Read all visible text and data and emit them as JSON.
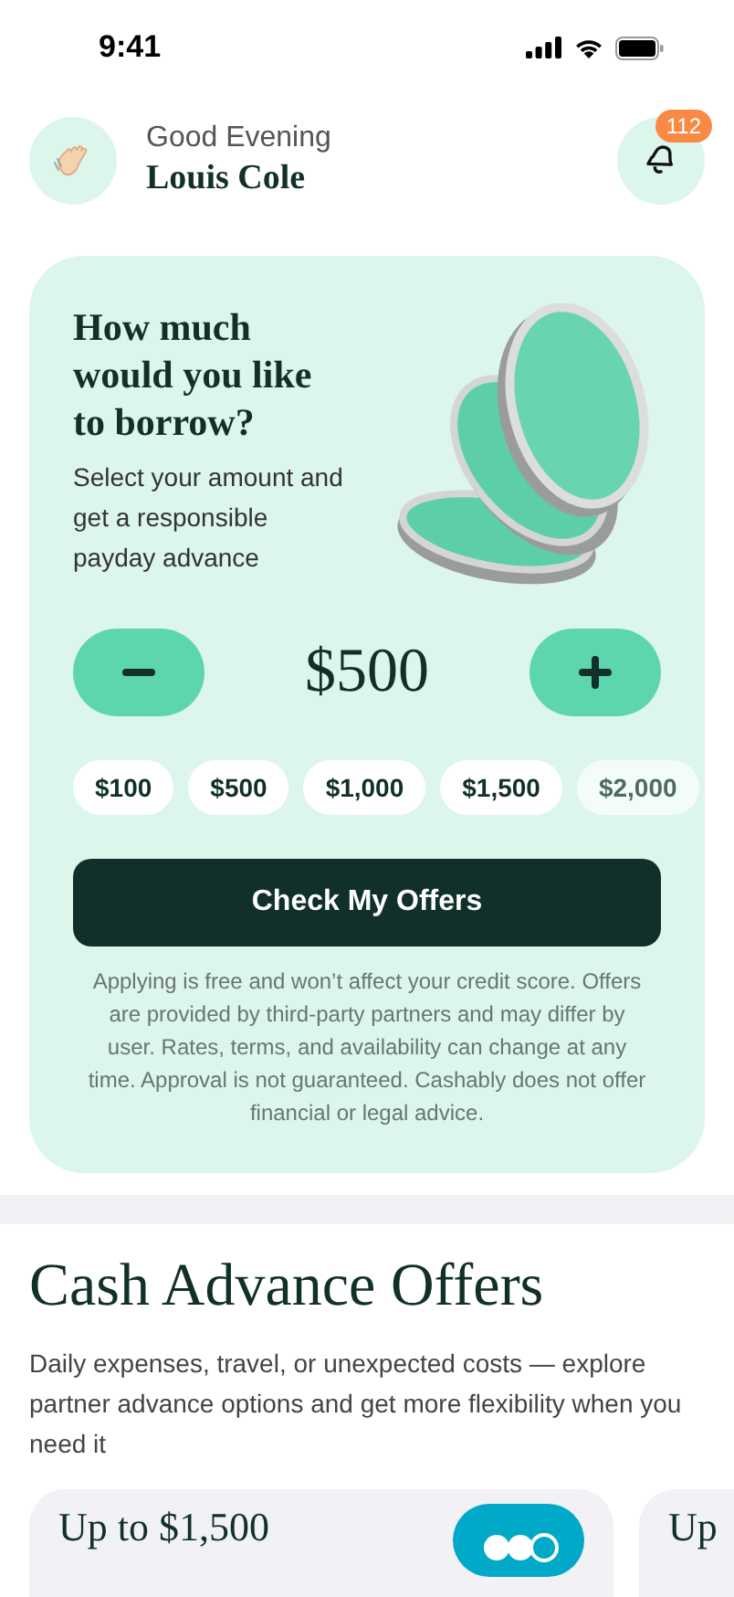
{
  "status_bar": {
    "time": "9:41"
  },
  "header": {
    "greeting": "Good Evening",
    "name": "Louis Cole",
    "notifications": "112"
  },
  "borrow_card": {
    "title": "How much would you like to borrow?",
    "subtitle": "Select your amount and get a responsible payday advance",
    "amount": "$500",
    "chips": [
      "$100",
      "$500",
      "$1,000",
      "$1,500",
      "$2,000"
    ],
    "button": "Check My Offers",
    "disclaimer": "Applying is free and won’t affect your credit score. Offers are provided by third-party partners and may differ by user. Rates, terms, and availability can change at any time. Approval is not guaranteed. Cashably does not offer financial or legal advice."
  },
  "offers": {
    "title": "Cash Advance Offers",
    "description": "Daily expenses, travel, or unexpected costs — explore partner advance options and get more flexibility when you need it",
    "cards": [
      {
        "title": "Up to $1,500"
      },
      {
        "title": "Up"
      }
    ]
  }
}
